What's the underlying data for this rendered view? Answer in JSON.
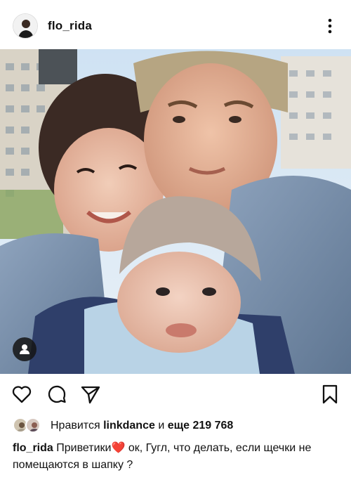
{
  "post": {
    "username": "flo_rida"
  },
  "likes": {
    "prefix": "Нравится",
    "user": "linkdance",
    "middle": "и",
    "more": "еще 219 768"
  },
  "caption": {
    "author": "flo_rida",
    "text_before": "Приветики",
    "emoji": "❤️",
    "text_after": " ок, Гугл, что делать, если щечки не помещаются в шапку ?"
  },
  "icons": {
    "more": "more-vertical-icon",
    "like": "heart-outline-icon",
    "comment": "comment-icon",
    "share": "paper-plane-icon",
    "save": "bookmark-icon",
    "tag": "user-tag-icon"
  },
  "colors": {
    "text": "#111111",
    "heart_emoji": "#e0245e"
  }
}
